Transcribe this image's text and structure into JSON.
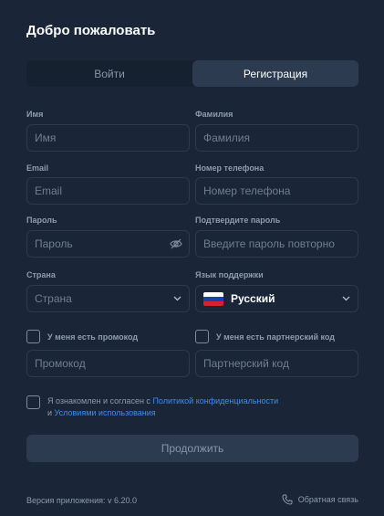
{
  "header": {
    "title": "Добро пожаловать"
  },
  "tabs": [
    {
      "label": "Войти",
      "active": false
    },
    {
      "label": "Регистрация",
      "active": true
    }
  ],
  "form": {
    "first_name": {
      "label": "Имя",
      "placeholder": "Имя",
      "value": ""
    },
    "last_name": {
      "label": "Фамилия",
      "placeholder": "Фамилия",
      "value": ""
    },
    "email": {
      "label": "Email",
      "placeholder": "Email",
      "value": ""
    },
    "phone": {
      "label": "Номер телефона",
      "placeholder": "Номер телефона",
      "value": ""
    },
    "password": {
      "label": "Пароль",
      "placeholder": "Пароль",
      "value": "",
      "icon": "eye-off-icon"
    },
    "confirm_password": {
      "label": "Подтвердите пароль",
      "placeholder": "Введите пароль повторно",
      "value": ""
    },
    "country": {
      "label": "Страна",
      "selected": "Страна"
    },
    "language": {
      "label": "Язык поддержки",
      "selected": "Русский",
      "flag": "russia-flag"
    },
    "promo": {
      "checkbox_label": "У меня есть промокод",
      "placeholder": "Промокод",
      "checked": false
    },
    "partner": {
      "checkbox_label": "У меня есть партнерский код",
      "placeholder": "Партнерский код",
      "checked": false
    },
    "agreement": {
      "prefix": "Я ознакомлен и согласен с",
      "privacy_link": "Политикой конфиденциальности",
      "connector": "и",
      "terms_link": "Условиями использования",
      "checked": false
    },
    "submit_label": "Продолжить"
  },
  "footer": {
    "version": "Версия приложения: v 6.20.0",
    "feedback_label": "Обратная связь"
  },
  "colors": {
    "background": "#1a2637",
    "panel": "#2c3b4f",
    "link": "#3f8cf0",
    "muted_text": "#8d9bab"
  }
}
